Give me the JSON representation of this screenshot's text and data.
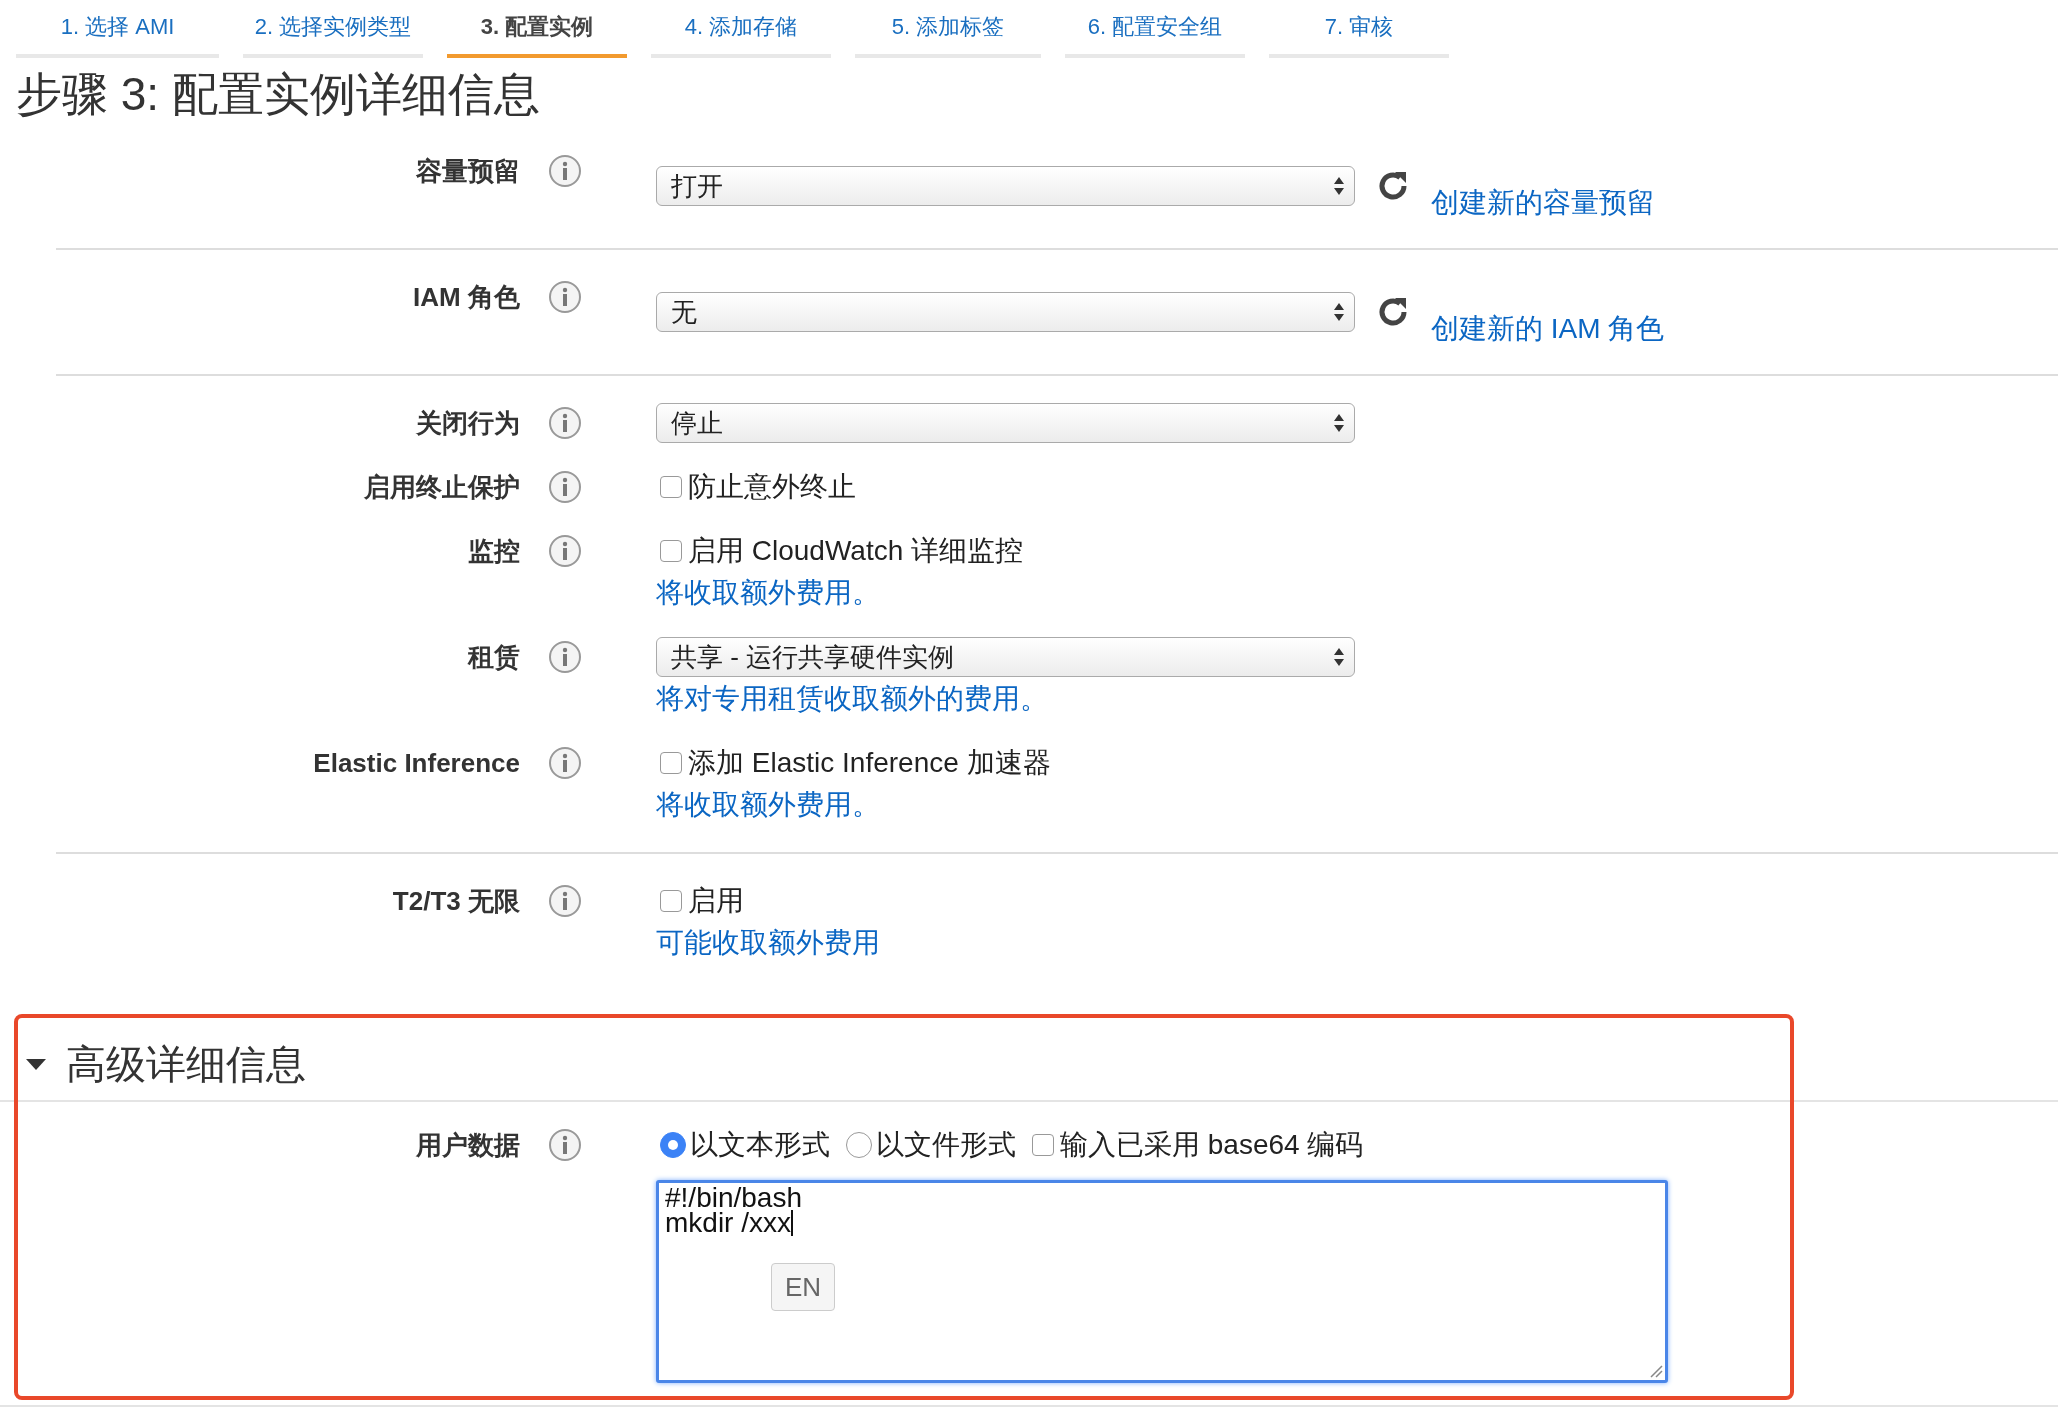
{
  "steps": [
    {
      "label": "1. 选择 AMI",
      "selected": false
    },
    {
      "label": "2. 选择实例类型",
      "selected": false
    },
    {
      "label": "3. 配置实例",
      "selected": true
    },
    {
      "label": "4. 添加存储",
      "selected": false
    },
    {
      "label": "5. 添加标签",
      "selected": false
    },
    {
      "label": "6. 配置安全组",
      "selected": false
    },
    {
      "label": "7. 审核",
      "selected": false
    }
  ],
  "heading": "步骤 3: 配置实例详细信息",
  "sections": [
    {
      "fields": [
        {
          "kind": "select",
          "label": "容量预留",
          "value": "打开",
          "action": "创建新的容量预留"
        }
      ]
    },
    {
      "fields": [
        {
          "kind": "select",
          "label": "IAM 角色",
          "value": "无",
          "action": "创建新的 IAM 角色"
        }
      ]
    },
    {
      "fields": [
        {
          "kind": "select",
          "label": "关闭行为",
          "value": "停止"
        },
        {
          "kind": "checkbox",
          "label": "启用终止保护",
          "option": "防止意外终止",
          "checked": false
        },
        {
          "kind": "checkbox",
          "label": "监控",
          "option": "启用 CloudWatch 详细监控",
          "checked": false,
          "note": "将收取额外费用。"
        },
        {
          "kind": "select",
          "label": "租赁",
          "value": "共享 - 运行共享硬件实例",
          "note": "将对专用租赁收取额外的费用。"
        },
        {
          "kind": "checkbox",
          "label": "Elastic Inference",
          "option": "添加 Elastic Inference 加速器",
          "checked": false,
          "note": "将收取额外费用。"
        }
      ]
    },
    {
      "fields": [
        {
          "kind": "checkbox",
          "label": "T2/T3 无限",
          "option": "启用",
          "checked": false,
          "note": "可能收取额外费用"
        }
      ]
    }
  ],
  "advanced": {
    "title": "高级详细信息",
    "expanded": true,
    "user_data": {
      "label": "用户数据",
      "options": [
        {
          "kind": "radio",
          "label": "以文本形式",
          "selected": true
        },
        {
          "kind": "radio",
          "label": "以文件形式",
          "selected": false
        },
        {
          "kind": "checkbox",
          "label": "输入已采用 base64 编码",
          "checked": false
        }
      ],
      "text": "#!/bin/bash\nmkdir /xxx",
      "ime_badge": "EN"
    }
  }
}
